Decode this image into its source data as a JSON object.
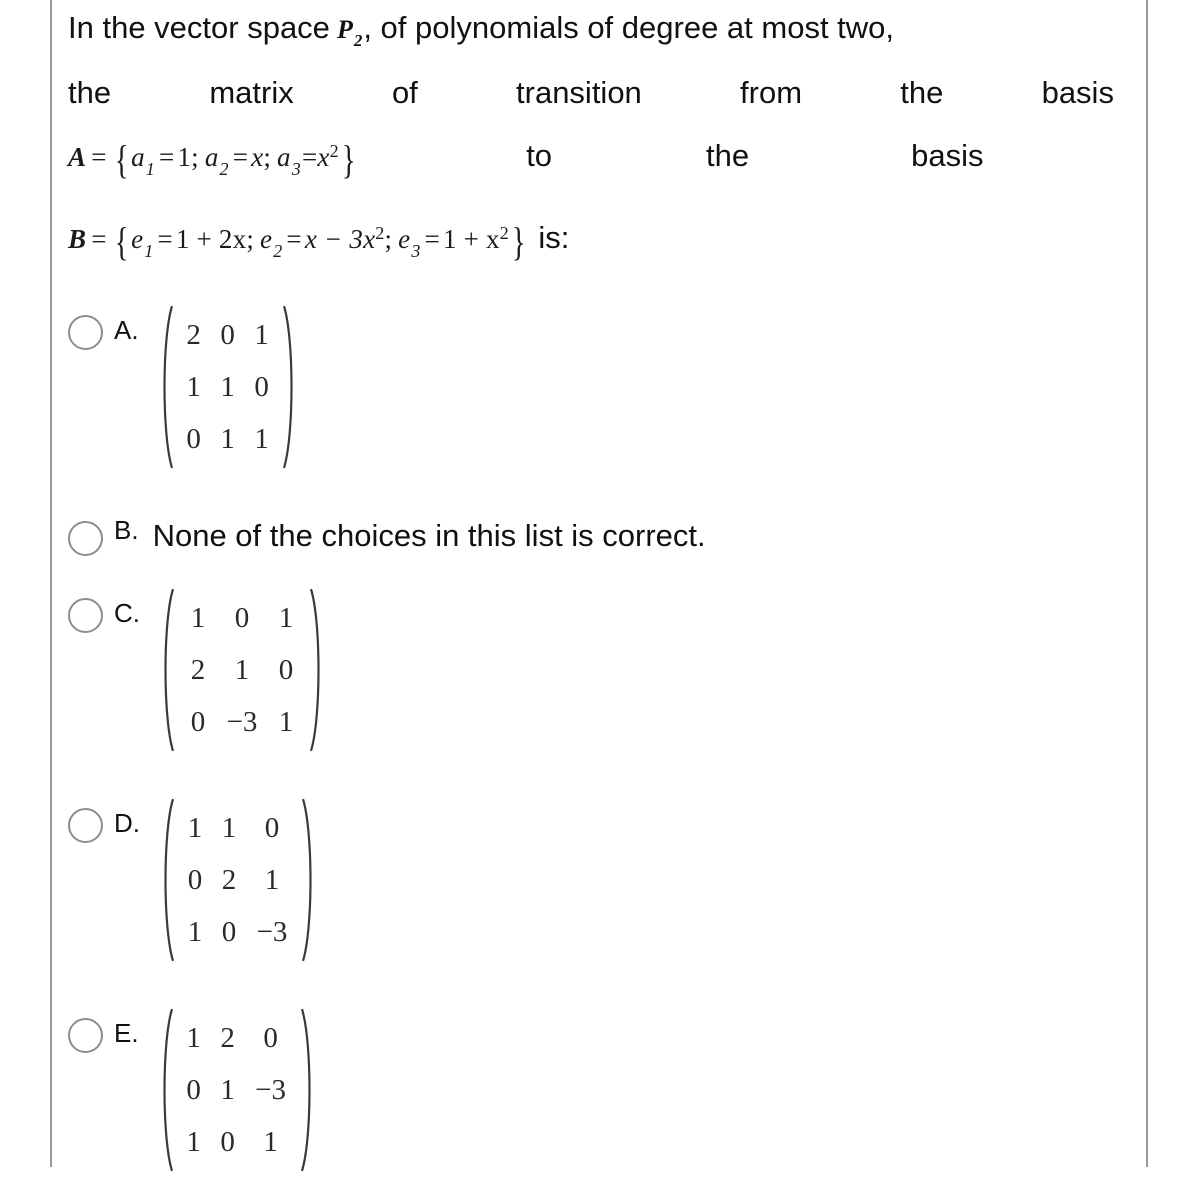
{
  "question": {
    "stem_lines": [
      [
        "In",
        "the",
        "vector",
        "space",
        "P2,",
        "of",
        "polynomials",
        "of",
        "degree",
        "at",
        "most",
        "two,"
      ],
      [
        "the",
        "matrix",
        "of",
        "transition",
        "from",
        "the",
        "basis"
      ],
      [
        "to",
        "the",
        "basis"
      ]
    ],
    "line1": {
      "before_math": "In the vector space",
      "math_symbol": "P",
      "math_subscript": "2",
      "after_math": ", of polynomials of degree at most two,"
    },
    "line2_words": [
      "the",
      "matrix",
      "of",
      "transition",
      "from",
      "the",
      "basis"
    ],
    "line3_words": [
      "to",
      "the",
      "basis"
    ],
    "basis_a": {
      "name": "A",
      "equals": "=",
      "open_brace": "{",
      "close_brace": "}",
      "terms": [
        {
          "var": "a",
          "sub": "1",
          "eq": "=",
          "value": "1",
          "sep": ";"
        },
        {
          "var": "a",
          "sub": "2",
          "eq": "=",
          "value": "x",
          "sep": ";"
        },
        {
          "var": "a",
          "sub": "3",
          "eq": "=",
          "value": "x",
          "sup": "2",
          "sep": ""
        }
      ],
      "plain": "A = {a1 = 1; a2 = x; a3 = x^2}"
    },
    "basis_b": {
      "name": "B",
      "equals": "=",
      "open_brace": "{",
      "close_brace": "}",
      "terms": [
        {
          "var": "e",
          "sub": "1",
          "eq": "=",
          "value": "1 + 2x",
          "sep": ";"
        },
        {
          "var": "e",
          "sub": "2",
          "eq": "=",
          "value": "x − 3x",
          "sup": "2",
          "sep": ";"
        },
        {
          "var": "e",
          "sub": "3",
          "eq": "=",
          "value": "1 + x",
          "sup": "2",
          "sep": ""
        }
      ],
      "plain": "B = {e1 = 1 + 2x; e2 = x − 3x^2; e3 = 1 + x^2}"
    },
    "is_label": "is:"
  },
  "choices": [
    {
      "letter": "A.",
      "type": "matrix",
      "matrix": [
        [
          "2",
          "0",
          "1"
        ],
        [
          "1",
          "1",
          "0"
        ],
        [
          "0",
          "1",
          "1"
        ]
      ]
    },
    {
      "letter": "B.",
      "type": "text",
      "text": "None of the choices in this list is correct."
    },
    {
      "letter": "C.",
      "type": "matrix",
      "matrix": [
        [
          "1",
          "0",
          "1"
        ],
        [
          "2",
          "1",
          "0"
        ],
        [
          "0",
          "−3",
          "1"
        ]
      ]
    },
    {
      "letter": "D.",
      "type": "matrix",
      "matrix": [
        [
          "1",
          "1",
          "0"
        ],
        [
          "0",
          "2",
          "1"
        ],
        [
          "1",
          "0",
          "−3"
        ]
      ]
    },
    {
      "letter": "E.",
      "type": "matrix",
      "matrix": [
        [
          "1",
          "2",
          "0"
        ],
        [
          "0",
          "1",
          "−3"
        ],
        [
          "1",
          "0",
          "1"
        ]
      ]
    }
  ],
  "colors": {
    "frame_rule": "#9a9a9a",
    "text": "#111111",
    "radio_border": "#8d8d8d",
    "background": "#ffffff"
  }
}
